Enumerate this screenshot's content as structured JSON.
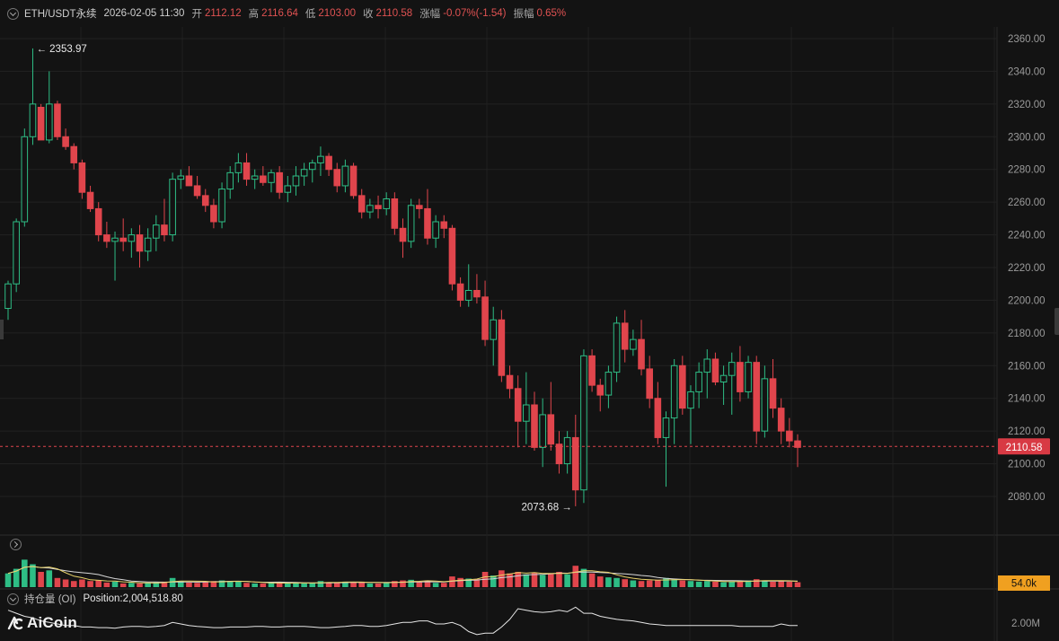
{
  "header": {
    "symbol": "ETH/USDT永续",
    "datetime": "2026-02-05 11:30",
    "open_label": "开",
    "open": "2112.12",
    "high_label": "高",
    "high": "2116.64",
    "low_label": "低",
    "low": "2103.00",
    "close_label": "收",
    "close": "2110.58",
    "change_label": "涨幅",
    "change": "-0.07%(-1.54)",
    "amplitude_label": "振幅",
    "amplitude": "0.65%"
  },
  "oi": {
    "label": "持仓量 (OI)",
    "position": "Position:2,004,518.80",
    "axis_label": "2.00M"
  },
  "logo": {
    "text": "AiCoin"
  },
  "colors": {
    "up": "#2ebd85",
    "down": "#e0454c",
    "bg": "#131313",
    "grid": "#242424",
    "ma_yellow": "#e8d26a",
    "ma_white": "#d8d8d8",
    "vol_tag": "#f0a020"
  },
  "chart_data": {
    "type": "candlestick",
    "y_ticks": [
      "2080.00",
      "2100.00",
      "2120.00",
      "2140.00",
      "2160.00",
      "2180.00",
      "2200.00",
      "2220.00",
      "2240.00",
      "2260.00",
      "2280.00",
      "2300.00",
      "2320.00",
      "2340.00",
      "2360.00"
    ],
    "ylim": [
      2067,
      2367
    ],
    "last_price": "2110.58",
    "max_annotation": "← 2353.97",
    "min_annotation": "2073.68 →",
    "volume_tag": "54.0k",
    "candles_ohlc": [
      [
        2195,
        2212,
        2188,
        2210
      ],
      [
        2210,
        2250,
        2205,
        2248
      ],
      [
        2248,
        2305,
        2245,
        2300
      ],
      [
        2300,
        2354,
        2295,
        2320
      ],
      [
        2318,
        2320,
        2298,
        2298
      ],
      [
        2298,
        2340,
        2296,
        2320
      ],
      [
        2320,
        2322,
        2298,
        2300
      ],
      [
        2300,
        2305,
        2292,
        2294
      ],
      [
        2294,
        2296,
        2280,
        2284
      ],
      [
        2284,
        2286,
        2262,
        2266
      ],
      [
        2266,
        2270,
        2254,
        2256
      ],
      [
        2256,
        2260,
        2236,
        2240
      ],
      [
        2240,
        2248,
        2232,
        2236
      ],
      [
        2236,
        2242,
        2212,
        2238
      ],
      [
        2238,
        2250,
        2230,
        2236
      ],
      [
        2236,
        2244,
        2226,
        2240
      ],
      [
        2240,
        2246,
        2220,
        2230
      ],
      [
        2230,
        2244,
        2224,
        2238
      ],
      [
        2238,
        2252,
        2230,
        2246
      ],
      [
        2246,
        2262,
        2236,
        2240
      ],
      [
        2240,
        2278,
        2236,
        2274
      ],
      [
        2274,
        2280,
        2268,
        2276
      ],
      [
        2276,
        2282,
        2270,
        2270
      ],
      [
        2270,
        2276,
        2262,
        2264
      ],
      [
        2264,
        2268,
        2254,
        2258
      ],
      [
        2258,
        2262,
        2244,
        2248
      ],
      [
        2248,
        2272,
        2244,
        2268
      ],
      [
        2268,
        2282,
        2262,
        2278
      ],
      [
        2278,
        2290,
        2272,
        2284
      ],
      [
        2284,
        2290,
        2270,
        2274
      ],
      [
        2274,
        2280,
        2268,
        2276
      ],
      [
        2276,
        2282,
        2270,
        2272
      ],
      [
        2272,
        2280,
        2266,
        2278
      ],
      [
        2278,
        2282,
        2262,
        2266
      ],
      [
        2266,
        2276,
        2260,
        2270
      ],
      [
        2270,
        2282,
        2264,
        2276
      ],
      [
        2276,
        2284,
        2270,
        2280
      ],
      [
        2280,
        2286,
        2272,
        2284
      ],
      [
        2284,
        2294,
        2276,
        2288
      ],
      [
        2288,
        2290,
        2276,
        2280
      ],
      [
        2280,
        2284,
        2266,
        2270
      ],
      [
        2270,
        2286,
        2266,
        2282
      ],
      [
        2282,
        2284,
        2262,
        2264
      ],
      [
        2264,
        2268,
        2250,
        2254
      ],
      [
        2254,
        2262,
        2250,
        2258
      ],
      [
        2258,
        2264,
        2250,
        2256
      ],
      [
        2256,
        2266,
        2252,
        2262
      ],
      [
        2262,
        2266,
        2240,
        2244
      ],
      [
        2244,
        2250,
        2226,
        2236
      ],
      [
        2236,
        2262,
        2232,
        2258
      ],
      [
        2258,
        2262,
        2250,
        2256
      ],
      [
        2256,
        2268,
        2234,
        2238
      ],
      [
        2238,
        2252,
        2232,
        2248
      ],
      [
        2248,
        2252,
        2238,
        2244
      ],
      [
        2244,
        2246,
        2206,
        2210
      ],
      [
        2210,
        2214,
        2196,
        2200
      ],
      [
        2200,
        2222,
        2196,
        2206
      ],
      [
        2206,
        2216,
        2198,
        2202
      ],
      [
        2202,
        2212,
        2172,
        2176
      ],
      [
        2176,
        2196,
        2160,
        2188
      ],
      [
        2188,
        2194,
        2150,
        2154
      ],
      [
        2154,
        2160,
        2140,
        2146
      ],
      [
        2146,
        2154,
        2110,
        2126
      ],
      [
        2126,
        2156,
        2112,
        2136
      ],
      [
        2136,
        2144,
        2108,
        2110
      ],
      [
        2110,
        2140,
        2098,
        2130
      ],
      [
        2130,
        2150,
        2108,
        2112
      ],
      [
        2112,
        2120,
        2094,
        2100
      ],
      [
        2100,
        2120,
        2094,
        2116
      ],
      [
        2116,
        2130,
        2074,
        2084
      ],
      [
        2084,
        2170,
        2076,
        2166
      ],
      [
        2166,
        2170,
        2144,
        2148
      ],
      [
        2148,
        2152,
        2132,
        2142
      ],
      [
        2142,
        2160,
        2134,
        2156
      ],
      [
        2156,
        2190,
        2150,
        2186
      ],
      [
        2186,
        2194,
        2162,
        2170
      ],
      [
        2170,
        2182,
        2166,
        2176
      ],
      [
        2176,
        2188,
        2154,
        2158
      ],
      [
        2158,
        2166,
        2134,
        2140
      ],
      [
        2140,
        2150,
        2112,
        2116
      ],
      [
        2116,
        2132,
        2086,
        2128
      ],
      [
        2128,
        2164,
        2112,
        2160
      ],
      [
        2160,
        2166,
        2130,
        2134
      ],
      [
        2134,
        2148,
        2112,
        2144
      ],
      [
        2144,
        2162,
        2134,
        2156
      ],
      [
        2156,
        2170,
        2140,
        2164
      ],
      [
        2164,
        2168,
        2148,
        2150
      ],
      [
        2150,
        2160,
        2136,
        2154
      ],
      [
        2154,
        2168,
        2130,
        2162
      ],
      [
        2162,
        2172,
        2138,
        2144
      ],
      [
        2144,
        2166,
        2140,
        2162
      ],
      [
        2162,
        2166,
        2112,
        2120
      ],
      [
        2120,
        2160,
        2116,
        2152
      ],
      [
        2152,
        2164,
        2128,
        2134
      ],
      [
        2134,
        2140,
        2112,
        2120
      ],
      [
        2120,
        2128,
        2110,
        2114
      ],
      [
        2114,
        2118,
        2098,
        2110
      ]
    ],
    "volume": [
      0.45,
      0.6,
      0.9,
      0.75,
      0.5,
      0.55,
      0.3,
      0.25,
      0.2,
      0.25,
      0.2,
      0.22,
      0.15,
      0.18,
      0.12,
      0.14,
      0.12,
      0.14,
      0.16,
      0.18,
      0.3,
      0.2,
      0.15,
      0.14,
      0.16,
      0.2,
      0.22,
      0.2,
      0.18,
      0.14,
      0.12,
      0.12,
      0.14,
      0.16,
      0.12,
      0.14,
      0.12,
      0.14,
      0.2,
      0.16,
      0.14,
      0.18,
      0.16,
      0.18,
      0.12,
      0.12,
      0.14,
      0.2,
      0.22,
      0.24,
      0.16,
      0.22,
      0.14,
      0.14,
      0.35,
      0.3,
      0.28,
      0.26,
      0.5,
      0.38,
      0.55,
      0.45,
      0.5,
      0.42,
      0.48,
      0.4,
      0.45,
      0.5,
      0.42,
      0.7,
      0.6,
      0.45,
      0.35,
      0.32,
      0.3,
      0.26,
      0.22,
      0.2,
      0.22,
      0.24,
      0.3,
      0.26,
      0.22,
      0.2,
      0.18,
      0.2,
      0.18,
      0.16,
      0.18,
      0.2,
      0.22,
      0.26,
      0.22,
      0.18,
      0.2,
      0.18,
      0.16
    ],
    "open_interest": [
      0.95,
      0.85,
      0.75,
      0.7,
      0.6,
      0.55,
      0.5,
      0.45,
      0.45,
      0.4,
      0.4,
      0.38,
      0.38,
      0.36,
      0.4,
      0.42,
      0.42,
      0.4,
      0.42,
      0.45,
      0.55,
      0.5,
      0.45,
      0.42,
      0.4,
      0.38,
      0.38,
      0.4,
      0.4,
      0.4,
      0.42,
      0.42,
      0.4,
      0.4,
      0.42,
      0.42,
      0.42,
      0.4,
      0.38,
      0.38,
      0.4,
      0.42,
      0.45,
      0.45,
      0.42,
      0.42,
      0.45,
      0.5,
      0.55,
      0.55,
      0.6,
      0.6,
      0.5,
      0.5,
      0.55,
      0.45,
      0.25,
      0.15,
      0.2,
      0.2,
      0.4,
      0.65,
      1.0,
      0.95,
      0.9,
      0.88,
      0.9,
      0.95,
      0.9,
      1.05,
      0.85,
      0.85,
      0.75,
      0.7,
      0.65,
      0.62,
      0.6,
      0.55,
      0.5,
      0.48,
      0.45,
      0.45,
      0.45,
      0.45,
      0.45,
      0.45,
      0.45,
      0.45,
      0.45,
      0.42,
      0.42,
      0.42,
      0.42,
      0.42,
      0.5,
      0.45,
      0.45
    ]
  }
}
